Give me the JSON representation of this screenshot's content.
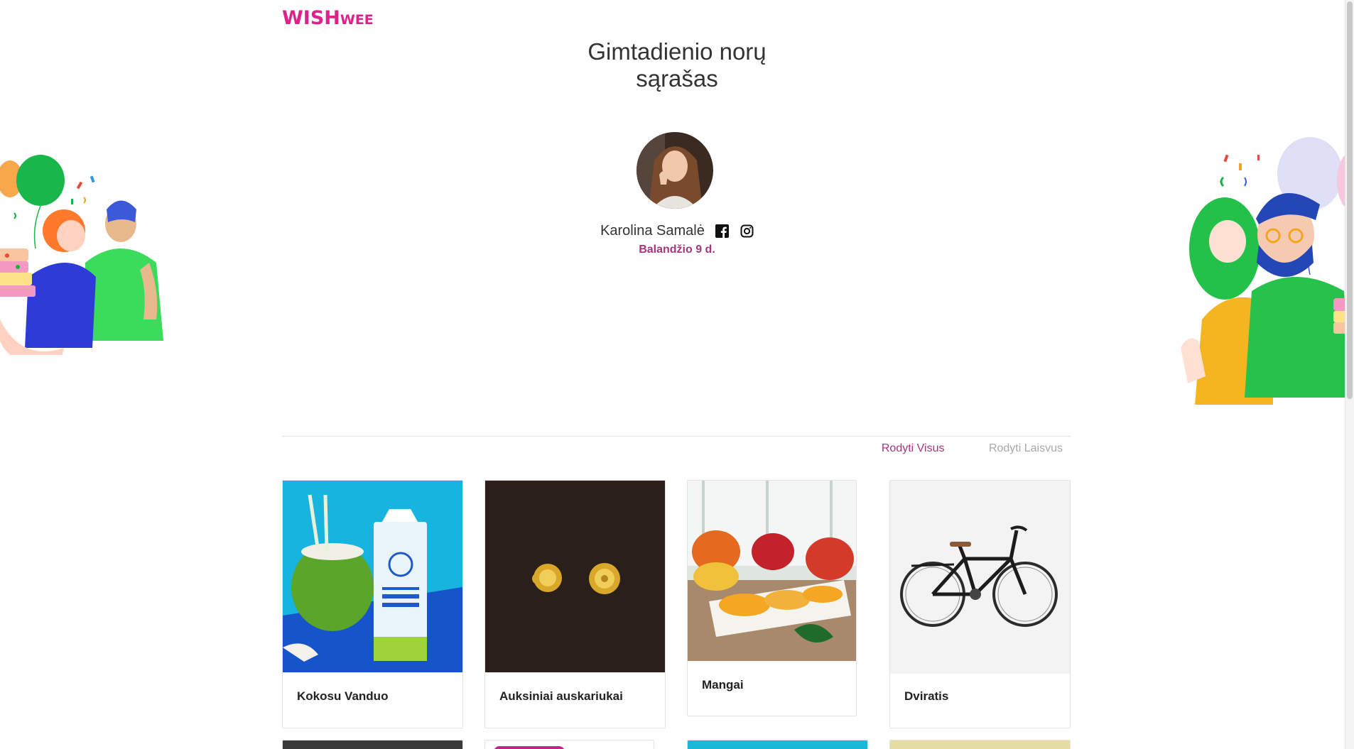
{
  "brand": {
    "logo_main": "WISH",
    "logo_sub": "WEE",
    "color": "#e0218a"
  },
  "wishlist": {
    "title_line1": "Gimtadienio norų",
    "title_line2": "sąrašas"
  },
  "profile": {
    "name": "Karolina Samalė",
    "birthday": "Balandžio 9 d.",
    "social_icons": [
      "facebook-icon",
      "instagram-icon"
    ]
  },
  "filters": {
    "show_all": "Rodyti Visus",
    "show_free": "Rodyti Laisvus",
    "active_color": "#a5357f"
  },
  "items": [
    {
      "title": "Kokosu Vanduo",
      "image": "coconut-water-image"
    },
    {
      "title": "Auksiniai auskariukai",
      "image": "gold-earrings-image"
    },
    {
      "title": "Mangai",
      "image": "mangoes-image"
    },
    {
      "title": "Dviratis",
      "image": "bicycle-image"
    }
  ]
}
